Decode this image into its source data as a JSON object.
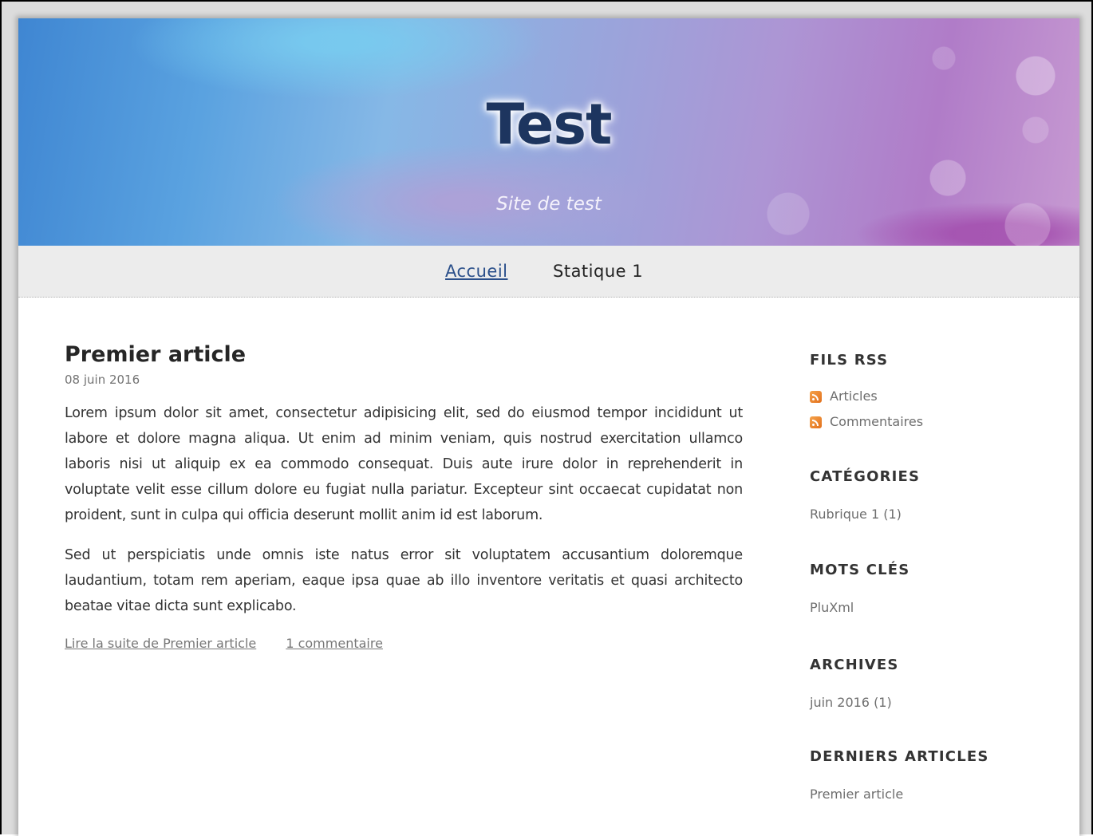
{
  "header": {
    "site_title": "Test",
    "site_subtitle": "Site de test"
  },
  "nav": {
    "items": [
      {
        "label": "Accueil",
        "active": true
      },
      {
        "label": "Statique 1",
        "active": false
      }
    ]
  },
  "article": {
    "title": "Premier article",
    "date": "08 juin 2016",
    "paragraphs": [
      "Lorem ipsum dolor sit amet, consectetur adipisicing elit, sed do eiusmod tempor incididunt ut labore et dolore magna aliqua. Ut enim ad minim veniam, quis nostrud exercitation ullamco laboris nisi ut aliquip ex ea commodo consequat. Duis aute irure dolor in reprehenderit in voluptate velit esse cillum dolore eu fugiat nulla pariatur. Excepteur sint occaecat cupidatat non proident, sunt in culpa qui officia deserunt mollit anim id est laborum.",
      "Sed ut perspiciatis unde omnis iste natus error sit voluptatem accusantium doloremque laudantium, totam rem aperiam, eaque ipsa quae ab illo inventore veritatis et quasi architecto beatae vitae dicta sunt explicabo."
    ],
    "read_more": "Lire la suite de Premier article",
    "comments_link": "1 commentaire"
  },
  "sidebar": {
    "rss": {
      "heading": "FILS RSS",
      "items": [
        "Articles",
        "Commentaires"
      ],
      "icon": "rss-icon"
    },
    "categories": {
      "heading": "CATÉGORIES",
      "items": [
        "Rubrique 1 (1)"
      ]
    },
    "tags": {
      "heading": "MOTS CLÉS",
      "items": [
        "PluXml"
      ]
    },
    "archives": {
      "heading": "ARCHIVES",
      "items": [
        "juin 2016 (1)"
      ]
    },
    "latest": {
      "heading": "DERNIERS ARTICLES",
      "items": [
        "Premier article"
      ]
    }
  },
  "colors": {
    "title": "#1d355f",
    "nav_active": "#2a4f8a",
    "nav_bg": "#ececec",
    "rss_orange": "#e98a2e"
  }
}
